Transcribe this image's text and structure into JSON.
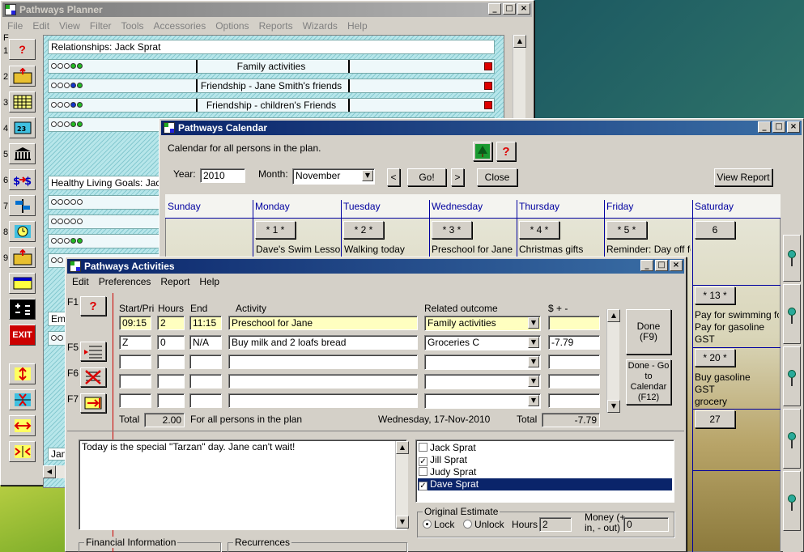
{
  "planner": {
    "title": "Pathways Planner",
    "menu": [
      "File",
      "Edit",
      "View",
      "Filter",
      "Tools",
      "Accessories",
      "Options",
      "Reports",
      "Wizards",
      "Help"
    ],
    "f_label": "F",
    "tool_numbers": [
      "1",
      "2",
      "3",
      "4",
      "5",
      "6",
      "7",
      "8",
      "9"
    ],
    "relationships_title": "Relationships: Jack Sprat",
    "rel_rows": [
      "Family activities",
      "Friendship - Jane Smith's friends",
      "Friendship - children's Friends",
      ""
    ],
    "healthy_title": "Healthy Living Goals: Jack S",
    "cut_labels": [
      "Jan",
      "Em"
    ],
    "exit_label": "EXIT",
    "help_label": "?"
  },
  "calendar": {
    "title": "Pathways Calendar",
    "subtitle": "Calendar for all persons in the plan.",
    "year_label": "Year:",
    "year_value": "2010",
    "month_label": "Month:",
    "month_value": "November",
    "prev_label": "<",
    "go_label": "Go!",
    "next_label": ">",
    "close_label": "Close",
    "view_report_label": "View Report",
    "help_label": "?",
    "days": [
      "Sunday",
      "Monday",
      "Tuesday",
      "Wednesday",
      "Thursday",
      "Friday",
      "Saturday"
    ],
    "week1_buttons": [
      "* 1 *",
      "* 2 *",
      "* 3 *",
      "* 4 *",
      "* 5 *",
      "6"
    ],
    "week1_notes": [
      "Dave's Swim Lesson",
      "Walking today",
      "Preschool for Jane",
      "Christmas gifts",
      "Reminder: Day off for"
    ],
    "sat_13": "* 13 *",
    "sat_13_notes": [
      "Pay for swimming for",
      "Pay for gasoline",
      "GST"
    ],
    "sat_20": "* 20 *",
    "sat_20_notes": [
      "Buy gasoline",
      "GST",
      "grocery"
    ],
    "sat_27": "27"
  },
  "activities": {
    "title": "Pathways Activities",
    "menu": [
      "Edit",
      "Preferences",
      "Report",
      "Help"
    ],
    "f_labels": [
      "F1",
      "F5",
      "F6",
      "F7"
    ],
    "help_label": "?",
    "headers": {
      "start": "Start/Pri",
      "hours": "Hours",
      "end": "End",
      "activity": "Activity",
      "outcome": "Related outcome",
      "money": "$ + -"
    },
    "rows": [
      {
        "start": "09:15",
        "hours": "2",
        "end": "11:15",
        "activity": "Preschool for Jane",
        "outcome": "Family activities",
        "money": ""
      },
      {
        "start": "Z",
        "hours": "0",
        "end": "N/A",
        "activity": "Buy milk and 2 loafs bread",
        "outcome": "Groceries C",
        "money": "-7.79"
      },
      {
        "start": "",
        "hours": "",
        "end": "",
        "activity": "",
        "outcome": "",
        "money": ""
      },
      {
        "start": "",
        "hours": "",
        "end": "",
        "activity": "",
        "outcome": "",
        "money": ""
      },
      {
        "start": "",
        "hours": "",
        "end": "",
        "activity": "",
        "outcome": "",
        "money": ""
      }
    ],
    "total_label": "Total",
    "total_hours": "2.00",
    "scope_text": "For all persons in the plan",
    "date_text": "Wednesday, 17-Nov-2010",
    "total_money_label": "Total",
    "total_money": "-7.79",
    "done_label": "Done (F9)",
    "done_go_label": "Done - Go to Calendar (F12)",
    "note_text": "Today is the special \"Tarzan\" day.  Jane can't wait!",
    "persons": [
      {
        "name": "Jack Sprat",
        "checked": false,
        "selected": false
      },
      {
        "name": "Jill Sprat",
        "checked": true,
        "selected": false
      },
      {
        "name": "Judy Sprat",
        "checked": false,
        "selected": false
      },
      {
        "name": "Dave Sprat",
        "checked": true,
        "selected": true
      }
    ],
    "estimate_title": "Original Estimate",
    "lock_label": "Lock",
    "unlock_label": "Unlock",
    "hours_label": "Hours",
    "hours_value": "2",
    "money_label": "Money (+ in, - out)",
    "money_value": "0",
    "financial_title": "Financial Information",
    "recurrences_title": "Recurrences"
  }
}
